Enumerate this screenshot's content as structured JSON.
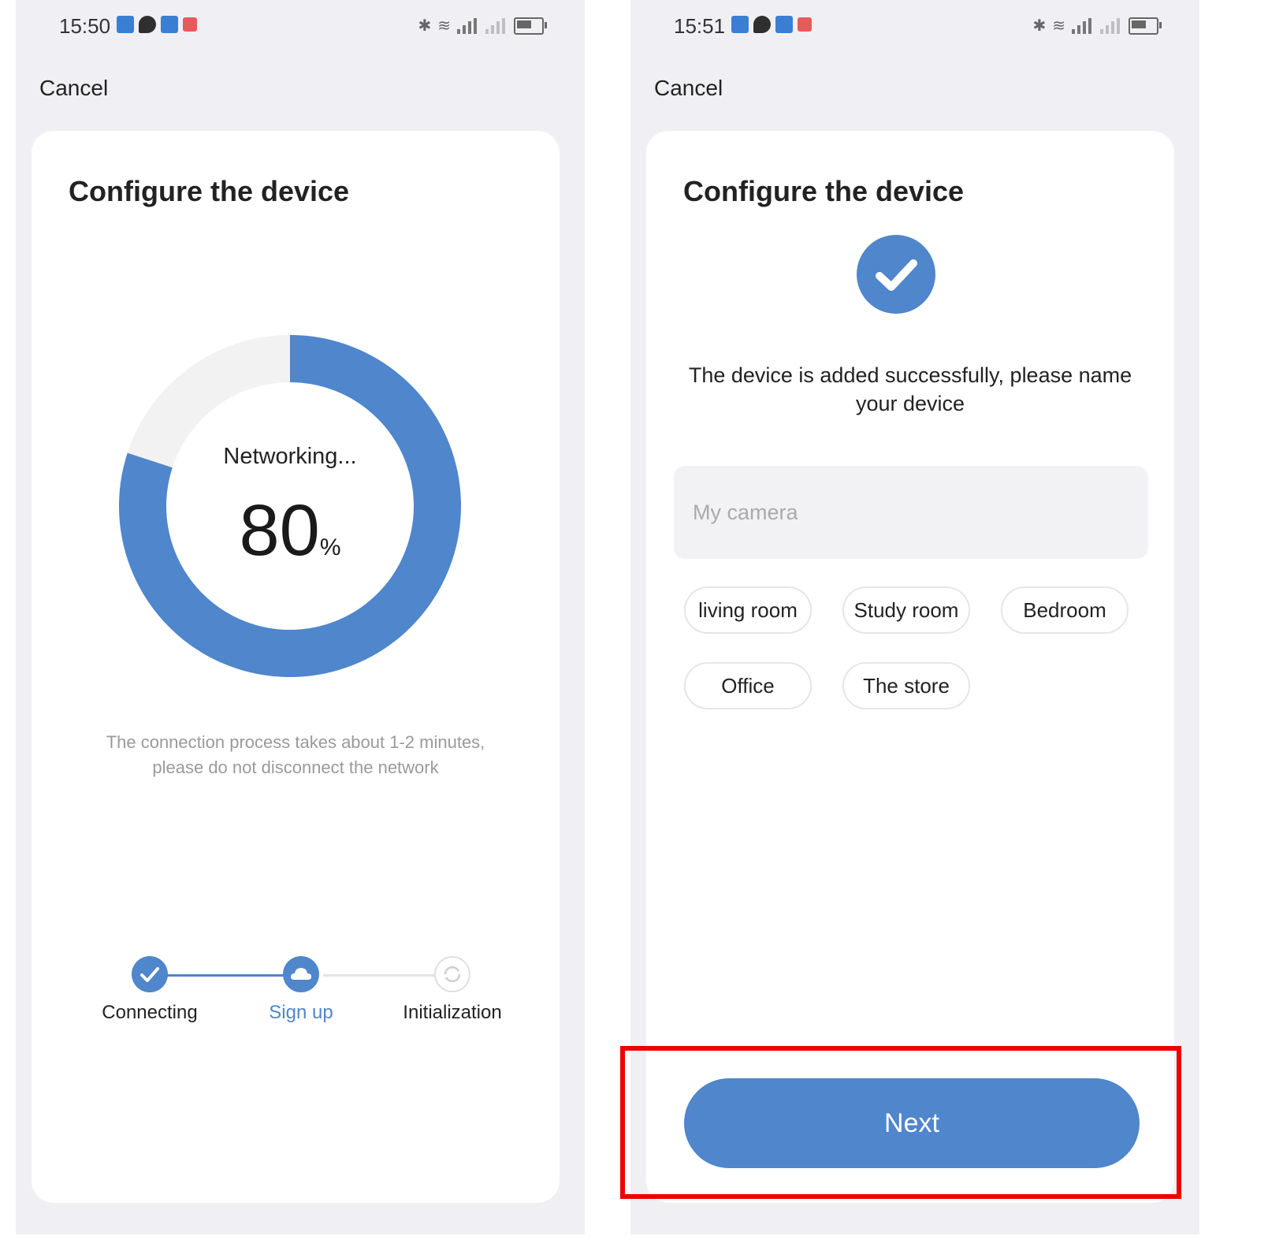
{
  "left_screen": {
    "status_time": "15:50",
    "cancel_label": "Cancel",
    "title": "Configure the device",
    "ring_label": "Networking...",
    "progress_value": "80",
    "progress_unit": "%",
    "progress_fraction": 0.8,
    "note_line1": "The connection process takes about 1-2 minutes,",
    "note_line2": "please do not disconnect the network",
    "steps": [
      {
        "label": "Connecting",
        "state": "done"
      },
      {
        "label": "Sign up",
        "state": "active"
      },
      {
        "label": "Initialization",
        "state": "pending"
      }
    ]
  },
  "right_screen": {
    "status_time": "15:51",
    "cancel_label": "Cancel",
    "title": "Configure the device",
    "success_line1": "The device is added successfully, please name",
    "success_line2": "your device",
    "name_placeholder": "My camera",
    "chips": [
      "living room",
      "Study room",
      "Bedroom",
      "Office",
      "The store"
    ],
    "next_label": "Next"
  },
  "colors": {
    "accent": "#4f86cc",
    "ring_track": "#f2f2f2",
    "highlight": "#ee0000",
    "page_bg": "#f0f0f4"
  },
  "icons": {
    "check": "check-icon",
    "cloud": "cloud-icon",
    "loading": "loading-icon"
  }
}
